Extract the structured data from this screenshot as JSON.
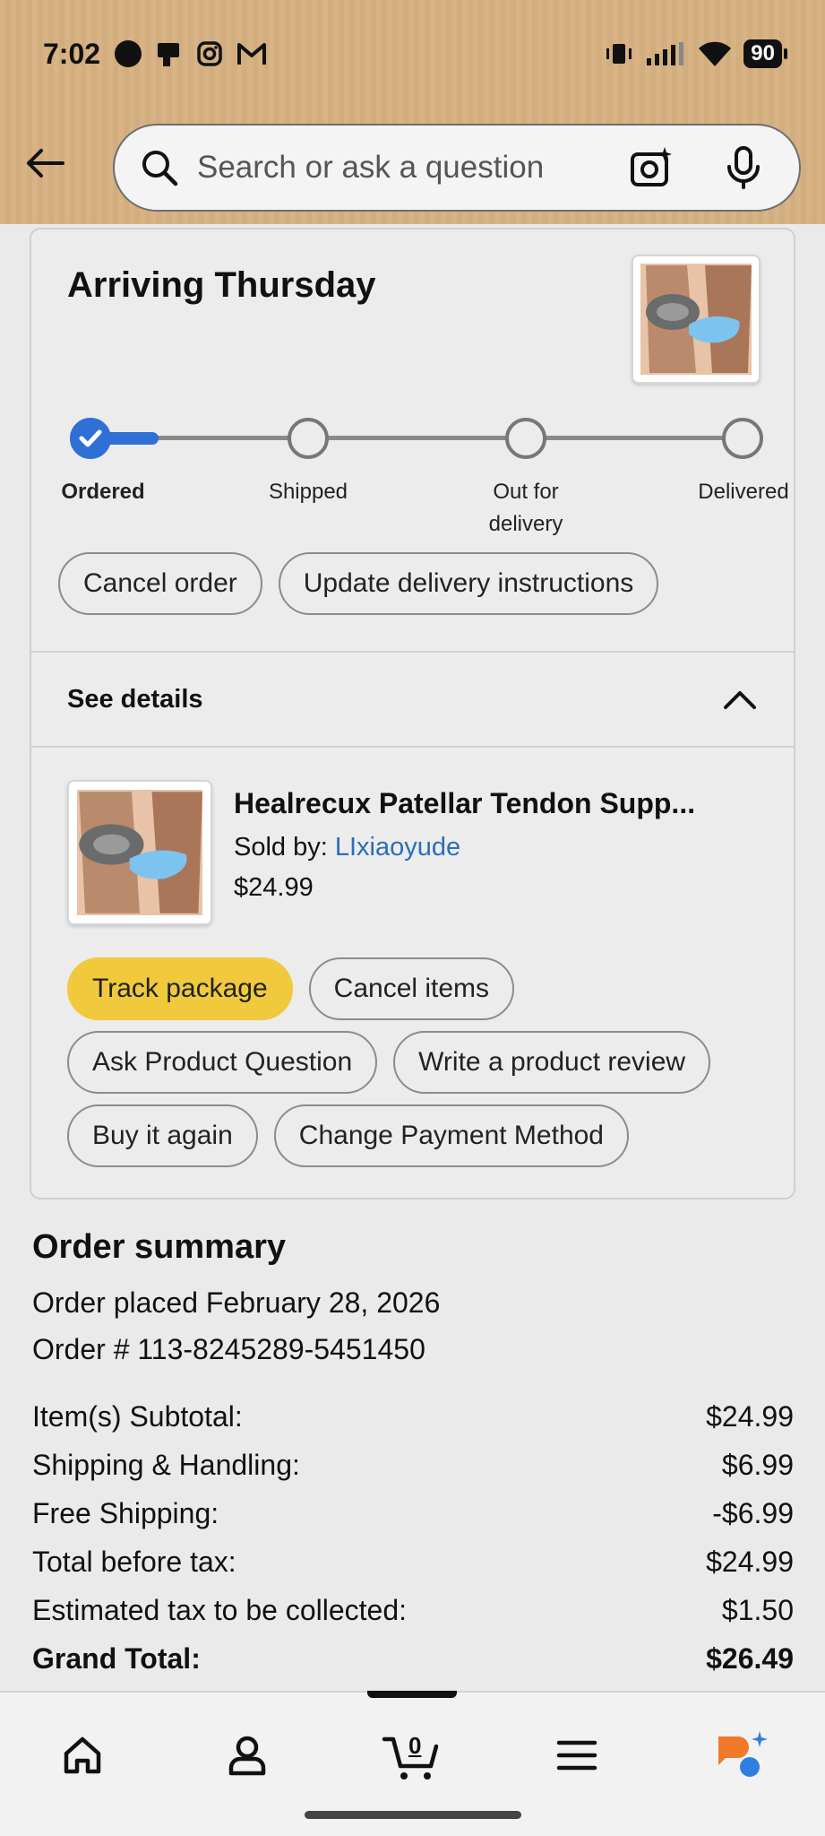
{
  "status_bar": {
    "time": "7:02",
    "battery": "90"
  },
  "search": {
    "placeholder": "Search or ask a question"
  },
  "delivery": {
    "heading": "Arriving Thursday",
    "progress_step": 1,
    "steps": [
      "Ordered",
      "Shipped",
      "Out for delivery",
      "Delivered"
    ],
    "actions": {
      "cancel_order": "Cancel order",
      "update_instructions": "Update delivery instructions"
    }
  },
  "details": {
    "label": "See details"
  },
  "item": {
    "title": "Healrecux Patellar Tendon Supp...",
    "sold_by_label": "Sold by: ",
    "seller": "LIxiaoyude",
    "price": "$24.99",
    "buttons": {
      "track": "Track package",
      "cancel_items": "Cancel items",
      "ask_question": "Ask Product Question",
      "write_review": "Write a product review",
      "buy_again": "Buy it again",
      "change_payment": "Change Payment Method"
    }
  },
  "summary": {
    "title": "Order summary",
    "placed": "Order placed February 28, 2026",
    "order_number": "Order # 113-8245289-5451450",
    "lines": [
      {
        "label": "Item(s) Subtotal:",
        "value": "$24.99"
      },
      {
        "label": "Shipping & Handling:",
        "value": "$6.99"
      },
      {
        "label": "Free Shipping:",
        "value": "-$6.99"
      },
      {
        "label": "Total before tax:",
        "value": "$24.99"
      },
      {
        "label": "Estimated tax to be collected:",
        "value": "$1.50"
      }
    ],
    "grand_total": {
      "label": "Grand Total:",
      "value": "$26.49"
    }
  },
  "bottom_nav": {
    "cart_count": "0"
  },
  "colors": {
    "header_bg": "#d7b385",
    "progress_blue": "#2f6fd6",
    "track_button": "#f0c93c",
    "seller_link": "#2a6ebb",
    "assistant_orange": "#f07a2a",
    "assistant_blue": "#2f7fe0"
  }
}
